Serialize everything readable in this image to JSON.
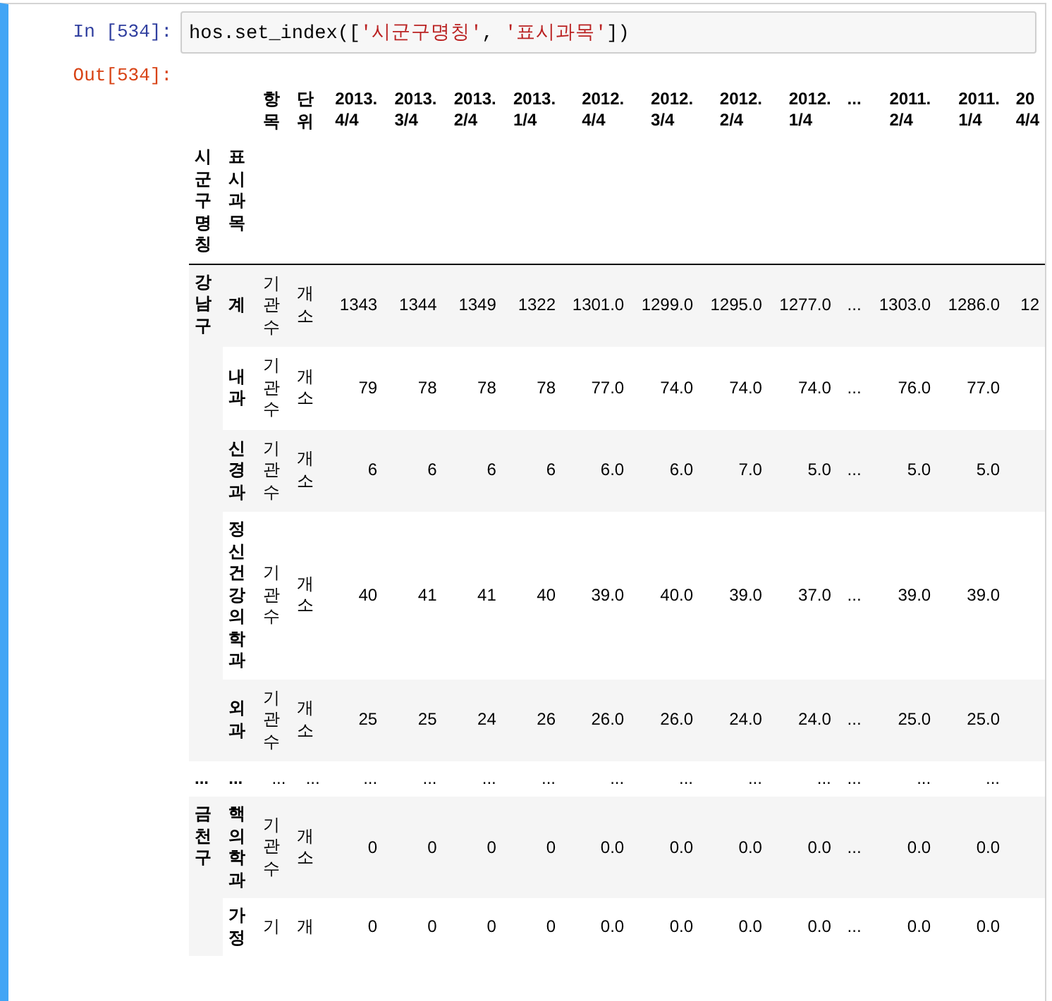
{
  "cell": {
    "input_prompt": "In [534]:",
    "code": [
      {
        "kind": "plain",
        "text": "hos.set_index(["
      },
      {
        "kind": "string",
        "text": "'시군구명칭'"
      },
      {
        "kind": "plain",
        "text": ", "
      },
      {
        "kind": "string",
        "text": "'표시과목'"
      },
      {
        "kind": "plain",
        "text": "])"
      }
    ],
    "output_prompt": "Out[534]:"
  },
  "table": {
    "columns": [
      "항목",
      "단위",
      "2013. 4/4",
      "2013. 3/4",
      "2013. 2/4",
      "2013. 1/4",
      "2012. 4/4",
      "2012. 3/4",
      "2012. 2/4",
      "2012. 1/4",
      "...",
      "2011. 2/4",
      "2011. 1/4",
      "20 4/4"
    ],
    "index_names": [
      "시군구명칭",
      "표시과목"
    ],
    "body": [
      {
        "kind": "group",
        "name": "강남구",
        "rows": [
          {
            "subject": "계",
            "item": "기관수",
            "unit": "개소",
            "values": [
              "1343",
              "1344",
              "1349",
              "1322",
              "1301.0",
              "1299.0",
              "1295.0",
              "1277.0",
              "...",
              "1303.0",
              "1286.0",
              "12"
            ]
          },
          {
            "subject": "내과",
            "item": "기관수",
            "unit": "개소",
            "values": [
              "79",
              "78",
              "78",
              "78",
              "77.0",
              "74.0",
              "74.0",
              "74.0",
              "...",
              "76.0",
              "77.0"
            ]
          },
          {
            "subject": "신경과",
            "item": "기관수",
            "unit": "개소",
            "values": [
              "6",
              "6",
              "6",
              "6",
              "6.0",
              "6.0",
              "7.0",
              "5.0",
              "...",
              "5.0",
              "5.0"
            ]
          },
          {
            "subject": "정신건강의학과",
            "item": "기관수",
            "unit": "개소",
            "values": [
              "40",
              "41",
              "41",
              "40",
              "39.0",
              "40.0",
              "39.0",
              "37.0",
              "...",
              "39.0",
              "39.0"
            ]
          },
          {
            "subject": "외과",
            "item": "기관수",
            "unit": "개소",
            "values": [
              "25",
              "25",
              "24",
              "26",
              "26.0",
              "26.0",
              "24.0",
              "24.0",
              "...",
              "25.0",
              "25.0"
            ]
          }
        ]
      },
      {
        "kind": "ellipsis",
        "cells": [
          "...",
          "...",
          "...",
          "...",
          "...",
          "...",
          "...",
          "...",
          "...",
          "...",
          "...",
          "...",
          "...",
          "...",
          "..."
        ]
      },
      {
        "kind": "group",
        "name": "금천구",
        "rows": [
          {
            "subject": "핵의학과",
            "item": "기관수",
            "unit": "개소",
            "values": [
              "0",
              "0",
              "0",
              "0",
              "0.0",
              "0.0",
              "0.0",
              "0.0",
              "...",
              "0.0",
              "0.0"
            ]
          },
          {
            "subject": "가정",
            "item": "기",
            "unit": "개",
            "values": [
              "0",
              "0",
              "0",
              "0",
              "0.0",
              "0.0",
              "0.0",
              "0.0",
              "...",
              "0.0",
              "0.0"
            ]
          }
        ]
      }
    ]
  }
}
